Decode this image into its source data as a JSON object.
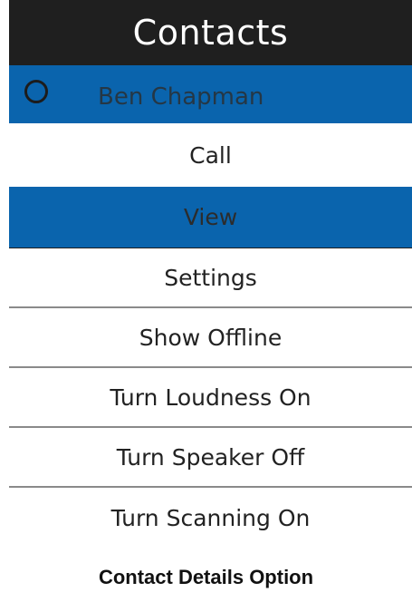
{
  "header": {
    "title": "Contacts"
  },
  "contact": {
    "name": "Ben Chapman",
    "status_icon": "presence-circle-icon"
  },
  "menu": {
    "items": [
      {
        "label": "Call"
      },
      {
        "label": "View"
      },
      {
        "label": "Settings"
      },
      {
        "label": "Show Offline"
      },
      {
        "label": "Turn Loudness On"
      },
      {
        "label": "Turn Speaker Off"
      },
      {
        "label": "Turn Scanning On"
      }
    ],
    "selected_label": "View"
  },
  "caption": "Contact Details Option",
  "colors": {
    "title_bar_bg": "#1f1f1f",
    "highlight": "#0a64ad",
    "divider": "#8a8a8a"
  }
}
